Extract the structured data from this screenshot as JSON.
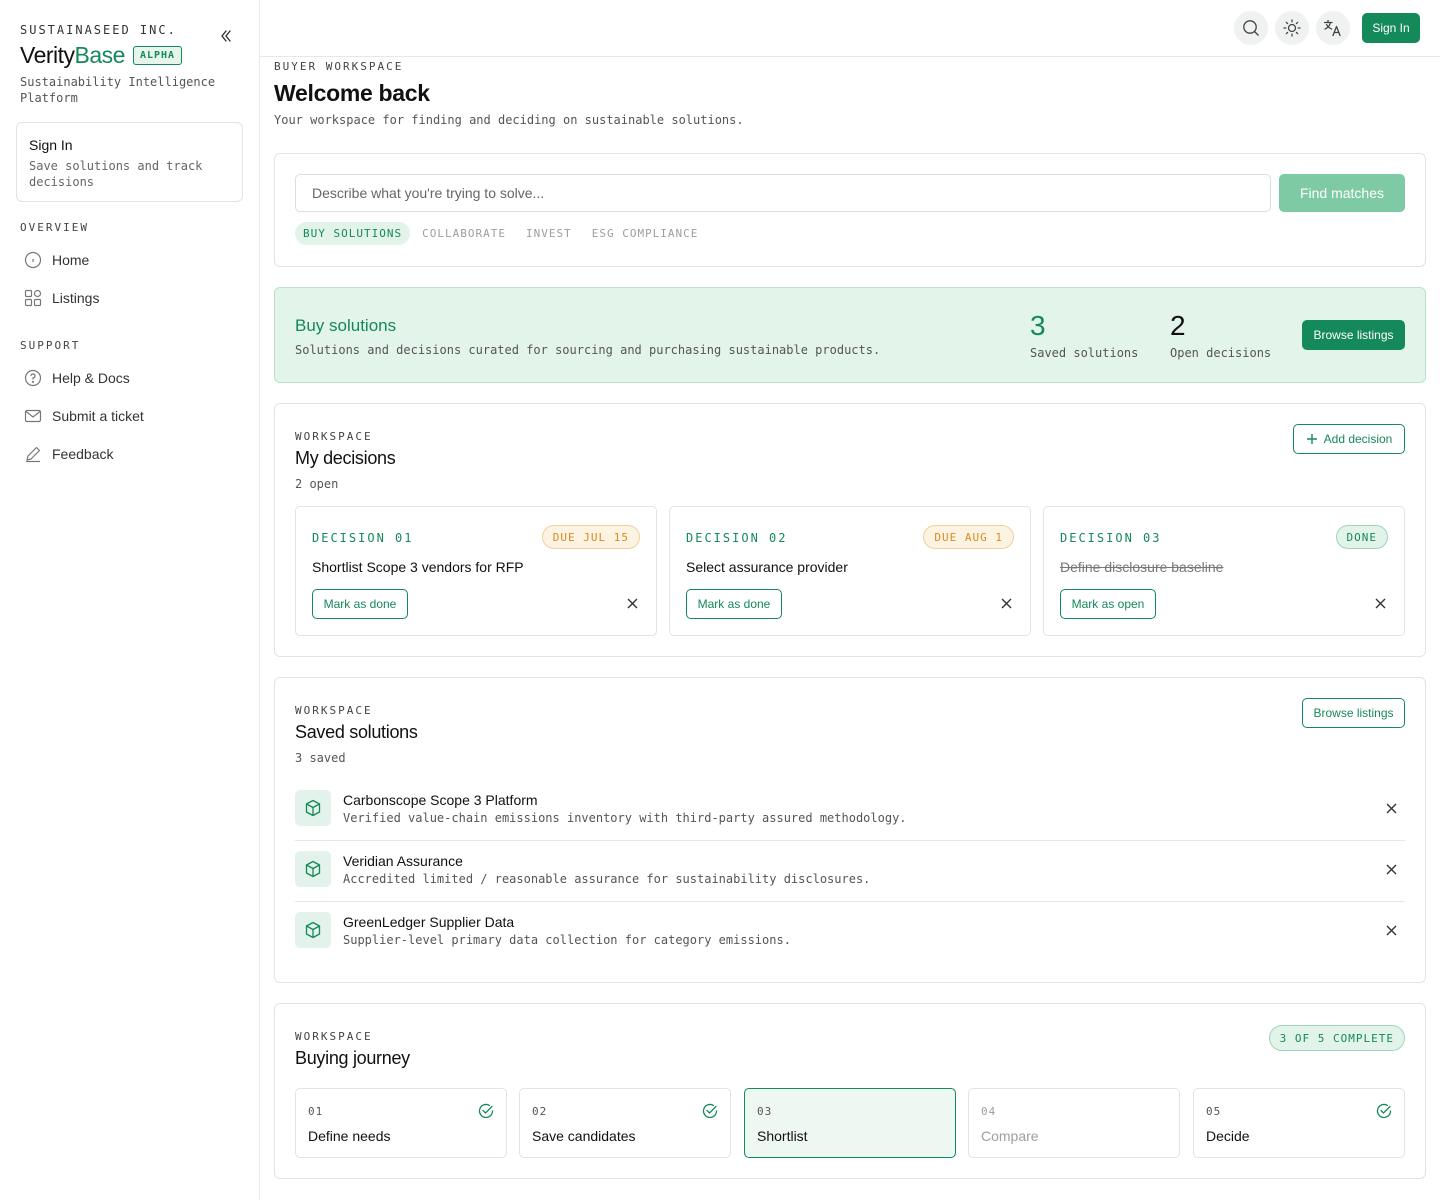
{
  "sidebar": {
    "company": "SUSTAINASEED INC.",
    "brand_part1": "Verity",
    "brand_part2": "Base",
    "badge": "ALPHA",
    "tagline": "Sustainability Intelligence Platform",
    "signin": {
      "title": "Sign In",
      "desc": "Save solutions and track decisions"
    },
    "sections": [
      {
        "label": "OVERVIEW",
        "items": [
          {
            "label": "Home",
            "icon": "home-icon"
          },
          {
            "label": "Listings",
            "icon": "grid-icon"
          }
        ]
      },
      {
        "label": "SUPPORT",
        "items": [
          {
            "label": "Help & Docs",
            "icon": "help-icon"
          },
          {
            "label": "Submit a ticket",
            "icon": "mail-icon"
          },
          {
            "label": "Feedback",
            "icon": "pencil-icon"
          }
        ]
      }
    ]
  },
  "topbar": {
    "signin_label": "Sign In"
  },
  "page": {
    "eyebrow": "BUYER WORKSPACE",
    "title": "Welcome back",
    "subtitle": "Your workspace for finding and deciding on sustainable solutions."
  },
  "search": {
    "placeholder": "Describe what you're trying to solve...",
    "value": "",
    "button": "Find matches",
    "tabs": [
      {
        "label": "BUY SOLUTIONS",
        "active": true
      },
      {
        "label": "COLLABORATE",
        "active": false
      },
      {
        "label": "INVEST",
        "active": false
      },
      {
        "label": "ESG COMPLIANCE",
        "active": false
      }
    ]
  },
  "banner": {
    "title": "Buy solutions",
    "subtitle": "Solutions and decisions curated for sourcing and purchasing sustainable products.",
    "stats": [
      {
        "value": "3",
        "label": "Saved solutions"
      },
      {
        "value": "2",
        "label": "Open decisions"
      }
    ],
    "button": "Browse listings"
  },
  "decisions": {
    "eyebrow": "WORKSPACE",
    "title": "My decisions",
    "count": "2 open",
    "add_button": "Add decision",
    "items": [
      {
        "num": "DECISION 01",
        "status": "DUE JUL 15",
        "status_type": "due",
        "title": "Shortlist Scope 3 vendors for RFP",
        "action": "Mark as done",
        "done": false
      },
      {
        "num": "DECISION 02",
        "status": "DUE AUG 1",
        "status_type": "due",
        "title": "Select assurance provider",
        "action": "Mark as done",
        "done": false
      },
      {
        "num": "DECISION 03",
        "status": "DONE",
        "status_type": "done",
        "title": "Define disclosure baseline",
        "action": "Mark as open",
        "done": true
      }
    ]
  },
  "saved": {
    "eyebrow": "WORKSPACE",
    "title": "Saved solutions",
    "count": "3 saved",
    "button": "Browse listings",
    "items": [
      {
        "name": "Carbonscope Scope 3 Platform",
        "desc": "Verified value-chain emissions inventory with third-party assured methodology."
      },
      {
        "name": "Veridian Assurance",
        "desc": "Accredited limited / reasonable assurance for sustainability disclosures."
      },
      {
        "name": "GreenLedger Supplier Data",
        "desc": "Supplier-level primary data collection for category emissions."
      }
    ]
  },
  "journey": {
    "eyebrow": "WORKSPACE",
    "title": "Buying journey",
    "progress": "3 OF 5 COMPLETE",
    "steps": [
      {
        "num": "01",
        "label": "Define needs",
        "state": "complete"
      },
      {
        "num": "02",
        "label": "Save candidates",
        "state": "complete"
      },
      {
        "num": "03",
        "label": "Shortlist",
        "state": "current"
      },
      {
        "num": "04",
        "label": "Compare",
        "state": "pending"
      },
      {
        "num": "05",
        "label": "Decide",
        "state": "complete"
      }
    ]
  },
  "colors": {
    "accent": "#14895a",
    "accent_light": "#e3f4eb",
    "due": "#d98b1f"
  }
}
